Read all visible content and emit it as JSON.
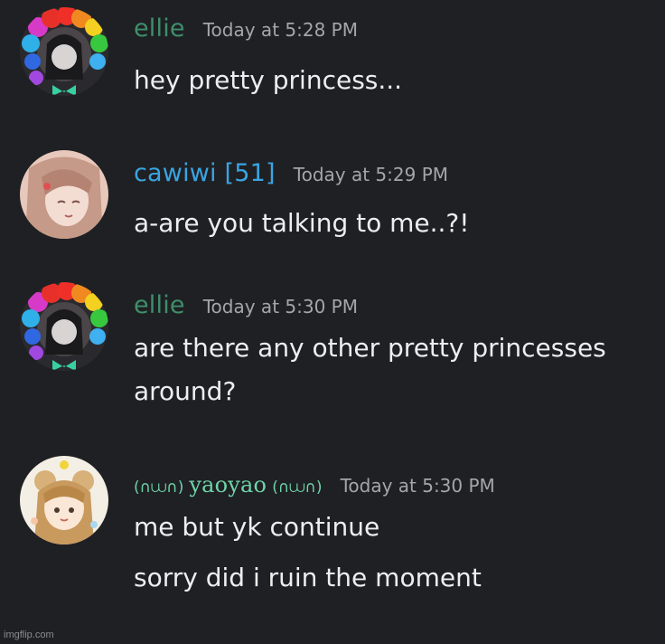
{
  "colors": {
    "background": "#1f2023",
    "ellie": "#3f8f6b",
    "cawiwi": "#3aa4e2",
    "yaoyao": "#6fd3a8",
    "timestamp": "#a3a6aa",
    "message": "#eceef0"
  },
  "messages": [
    {
      "author": "ellie",
      "avatar": "rainbow-clown-avatar-icon",
      "timestamp": "Today at 5:28 PM",
      "lines": [
        "hey pretty princess..."
      ]
    },
    {
      "author": "cawiwi [51]",
      "avatar": "anime-girl-avatar-icon",
      "timestamp": "Today at 5:29 PM",
      "lines": [
        "a-are you talking to me..?!"
      ]
    },
    {
      "author": "ellie",
      "avatar": "rainbow-clown-avatar-icon",
      "timestamp": "Today at 5:30 PM",
      "lines": [
        "are there any other pretty princesses",
        "around?"
      ]
    },
    {
      "author_prefix": "(∩⩊∩)",
      "author": "yaoyao",
      "author_suffix": "(∩⩊∩)",
      "avatar": "bear-girl-avatar-icon",
      "timestamp": "Today at 5:30 PM",
      "lines": [
        "me but yk continue",
        "sorry did i ruin the moment"
      ]
    }
  ],
  "watermark": "imgflip.com"
}
